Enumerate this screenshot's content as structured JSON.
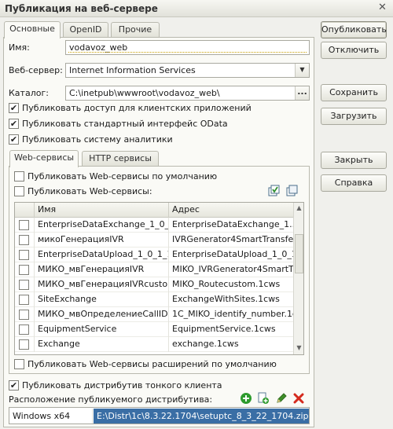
{
  "window": {
    "title": "Публикация на веб-сервере",
    "close_glyph": "✕"
  },
  "tabs": [
    {
      "label": "Основные"
    },
    {
      "label": "OpenID"
    },
    {
      "label": "Прочие"
    }
  ],
  "form": {
    "name_label": "Имя:",
    "name_value": "vodavoz_web",
    "server_label": "Веб-сервер:",
    "server_value": "Internet Information Services",
    "catalog_label": "Каталог:",
    "catalog_value": "C:\\inetpub\\wwwroot\\vodavoz_web\\",
    "catalog_button": "...",
    "checks": [
      {
        "label": "Публиковать доступ для клиентских приложений",
        "checked": true
      },
      {
        "label": "Публиковать стандартный интерфейс OData",
        "checked": true
      },
      {
        "label": "Публиковать систему аналитики",
        "checked": true
      }
    ]
  },
  "services_tabs": [
    {
      "label": "Web-сервисы"
    },
    {
      "label": "HTTP сервисы"
    }
  ],
  "services": {
    "default_check": {
      "label": "Публиковать Web-сервисы по умолчанию",
      "checked": false
    },
    "publish_check": {
      "label": "Публиковать Web-сервисы:",
      "checked": false
    },
    "columns": {
      "name": "Имя",
      "address": "Адрес"
    },
    "rows": [
      {
        "name": "EnterpriseDataExchange_1_0_1...",
        "address": "EnterpriseDataExchange_1...",
        "checked": false
      },
      {
        "name": "микоГенерацияIVR",
        "address": "IVRGenerator4SmartTransfer...",
        "checked": false
      },
      {
        "name": "EnterpriseDataUpload_1_0_1_1",
        "address": "EnterpriseDataUpload_1_0_1...",
        "checked": false
      },
      {
        "name": "МИКО_мвГенерацияIVR",
        "address": "MIKO_IVRGenerator4SmartTr...",
        "checked": false
      },
      {
        "name": "МИКО_мвГенерацияIVRcustom",
        "address": "MIKO_Routecustom.1cws",
        "checked": false
      },
      {
        "name": "SiteExchange",
        "address": "ExchangeWithSites.1cws",
        "checked": false
      },
      {
        "name": "МИКО_мвОпределениеCallID",
        "address": "1C_MIKO_identify_number.1c...",
        "checked": false
      },
      {
        "name": "EquipmentService",
        "address": "EquipmentService.1cws",
        "checked": false
      },
      {
        "name": "Exchange",
        "address": "exchange.1cws",
        "checked": false
      }
    ],
    "extensions_check": {
      "label": "Публиковать Web-сервисы расширений по умолчанию",
      "checked": false
    }
  },
  "distributive": {
    "thin_client_check": {
      "label": "Публиковать дистрибутив тонкого клиента",
      "checked": true
    },
    "location_label": "Расположение публикуемого дистрибутива:",
    "rows": [
      {
        "os": "Windows x64",
        "path": "E:\\Distr\\1c\\8.3.22.1704\\setuptc_8_3_22_1704.zip"
      }
    ]
  },
  "buttons": {
    "publish": "Опубликовать",
    "unpublish": "Отключить",
    "save": "Сохранить",
    "load": "Загрузить",
    "close": "Закрыть",
    "help": "Справка"
  },
  "colors": {
    "selected_row": "#3a6ea5",
    "add_icon": "#2e9b2e",
    "delete_icon": "#d42a1e",
    "edit_icon": "#3f8f2a"
  }
}
